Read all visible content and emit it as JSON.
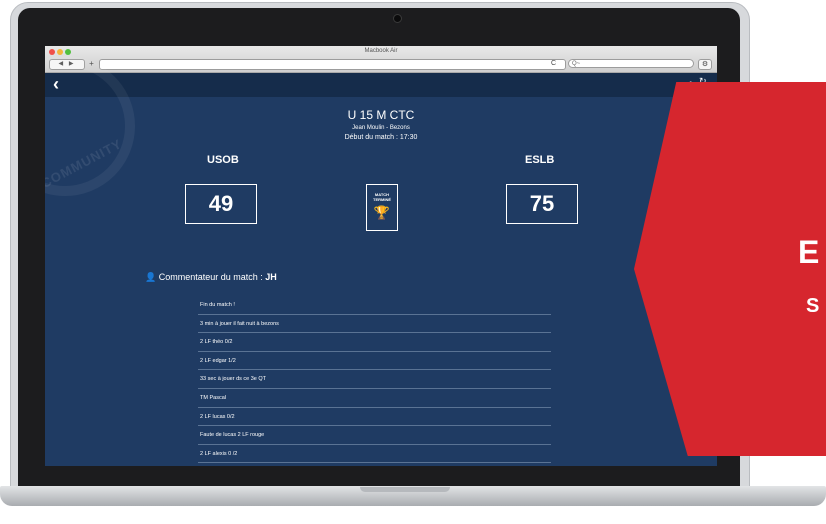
{
  "window": {
    "title": "Macbook Air",
    "nav_arrows": "◀ ▶",
    "new_tab": "+",
    "reload": "C",
    "search_placeholder": "Q~",
    "settings_icon": "gear-icon"
  },
  "app": {
    "back_icon": "chevron-left-icon",
    "back_glyph": "‹",
    "time_label": "2",
    "refresh_icon": "refresh-icon"
  },
  "match": {
    "title": "U 15 M CTC",
    "venue": "Jean Moulin - Bezons",
    "start_time": "Début du match : 17:30",
    "home_team": "USOB",
    "away_team": "ESLB",
    "home_score": "49",
    "away_score": "75",
    "status": "MATCH TERMINÉ",
    "status_icon": "trophy-icon"
  },
  "commentator": {
    "label": "Commentateur du match : ",
    "name": "JH",
    "icon": "user-icon"
  },
  "feed": [
    "Fin du match !",
    "3 min à jouer il fait nuit à bezons",
    "2 LF théo 0/2",
    "2 LF edgar 1/2",
    "33 sec à jouer ds ce 3e QT",
    "TM Pascal",
    "2 LF lucas 0/2",
    "Faute de lucas 2 LF rouge",
    "2 LF alexis 0 /2"
  ],
  "promo": {
    "big_text": "E",
    "small_text": "S"
  },
  "colors": {
    "app_background": "#1f3b63",
    "app_bar": "#152c4b",
    "promo_red": "#d6262e"
  }
}
